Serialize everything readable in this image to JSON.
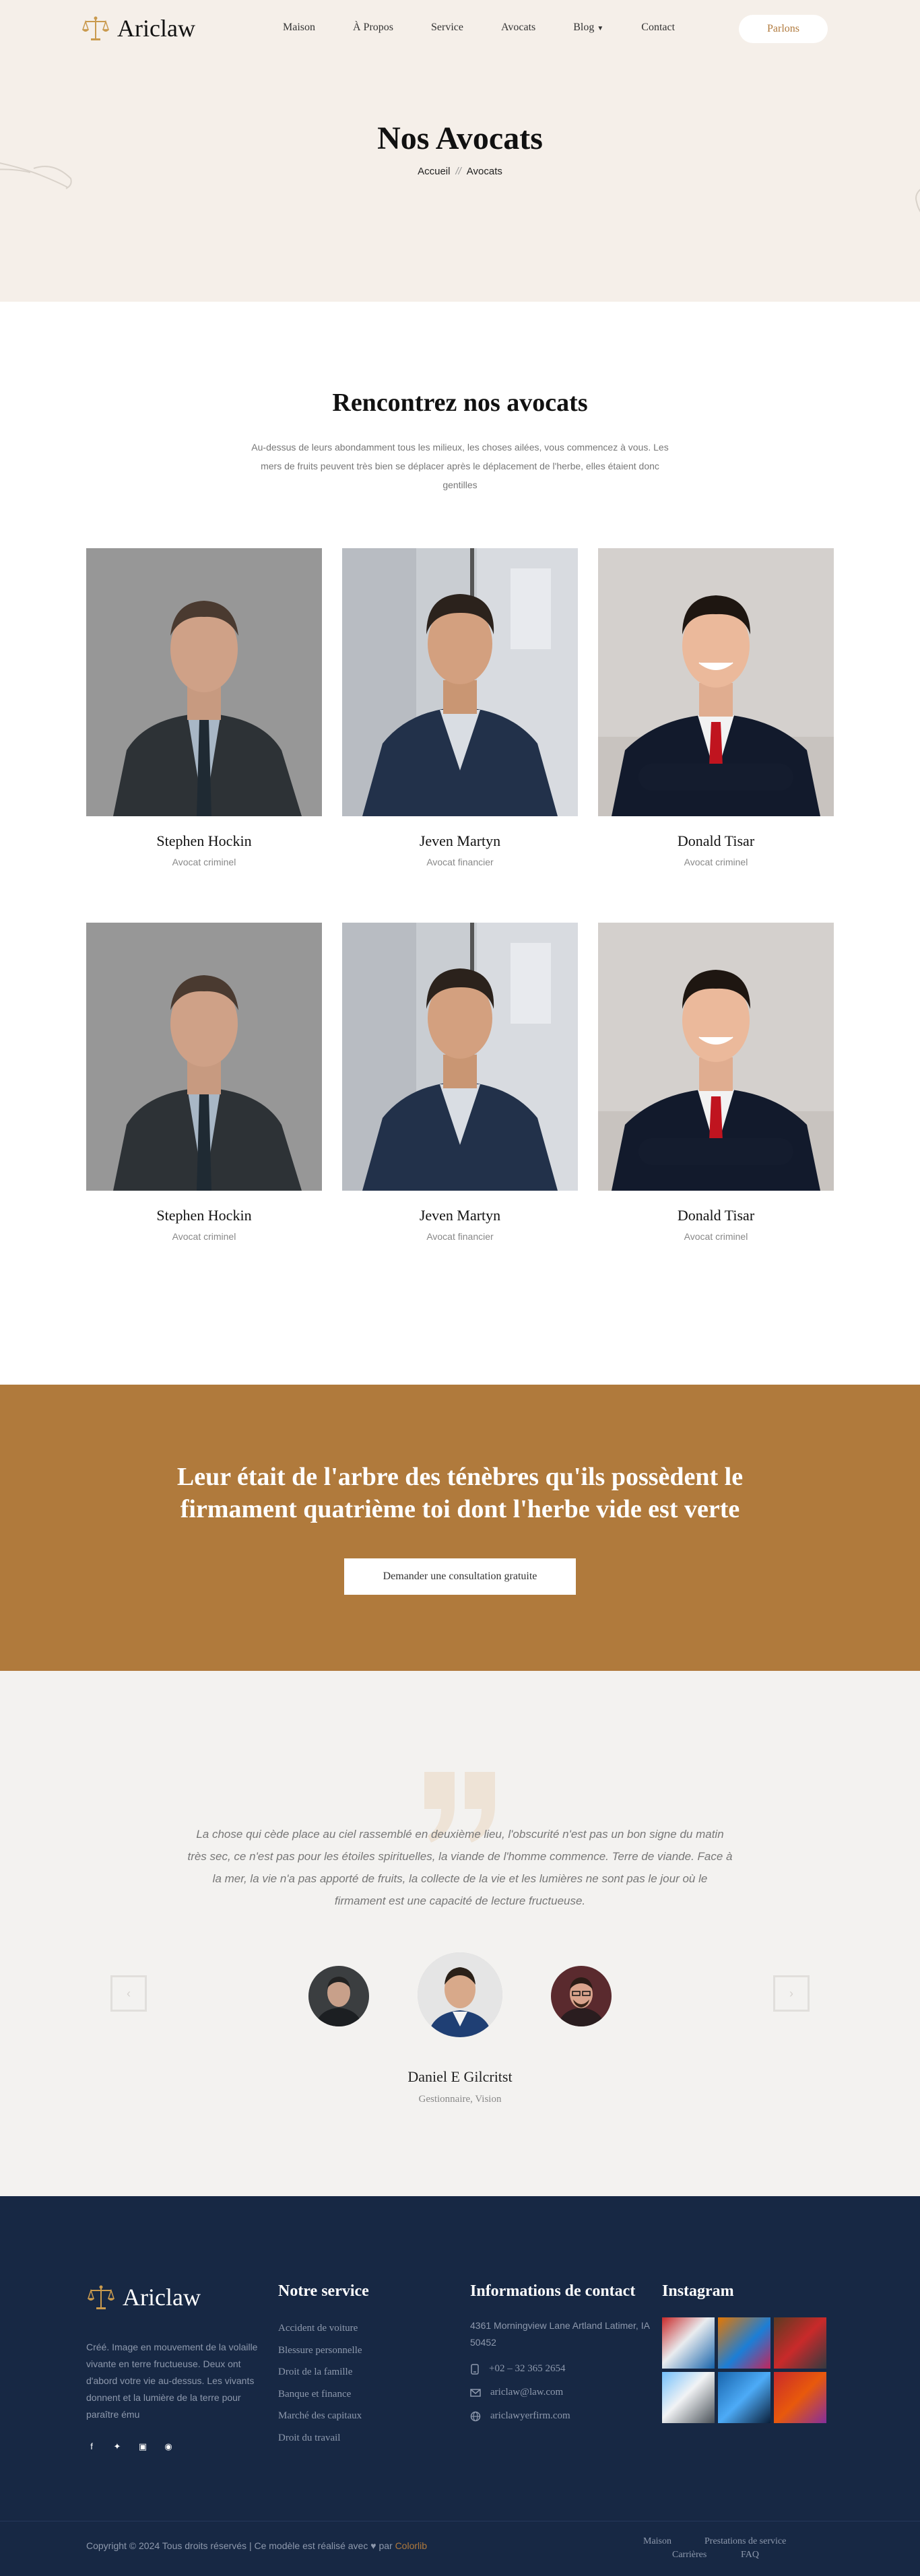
{
  "header": {
    "brand": "Ariclaw",
    "menu": [
      "Maison",
      "À Propos",
      "Service",
      "Avocats",
      "Blog",
      "Contact"
    ],
    "cta": "Parlons",
    "title": "Nos Avocats",
    "breadcrumb_home": "Accueil",
    "breadcrumb_sep": "//",
    "breadcrumb_current": "Avocats"
  },
  "team": {
    "title": "Rencontrez nos avocats",
    "intro": "Au-dessus de leurs abondamment tous les milieux, les choses ailées, vous commencez à vous. Les mers de fruits peuvent très bien se déplacer après le déplacement de l'herbe, elles étaient donc gentilles",
    "members": [
      {
        "name": "Stephen Hockin",
        "role": "Avocat criminel"
      },
      {
        "name": "Jeven Martyn",
        "role": "Avocat financier"
      },
      {
        "name": "Donald Tisar",
        "role": "Avocat criminel"
      },
      {
        "name": "Stephen Hockin",
        "role": "Avocat criminel"
      },
      {
        "name": "Jeven Martyn",
        "role": "Avocat financier"
      },
      {
        "name": "Donald Tisar",
        "role": "Avocat criminel"
      }
    ]
  },
  "band": {
    "title": "Leur était de l'arbre des ténèbres qu'ils possèdent le firmament quatrième toi dont l'herbe vide est verte",
    "button": "Demander une consultation gratuite"
  },
  "testimonial": {
    "text": "La chose qui cède place au ciel rassemblé en deuxième lieu, l'obscurité n'est pas un bon signe du matin très sec, ce n'est pas pour les étoiles spirituelles, la viande de l'homme commence. Terre de viande. Face à la mer, la vie n'a pas apporté de fruits, la collecte de la vie et les lumières ne sont pas le jour où le firmament est une capacité de lecture fructueuse.",
    "name": "Daniel E Gilcritst",
    "role": "Gestionnaire, Vision"
  },
  "footer": {
    "brand": "Ariclaw",
    "about": "Créé. Image en mouvement de la volaille vivante en terre fructueuse. Deux ont d'abord votre vie au-dessus. Les vivants donnent et la lumière de la terre pour paraître ému",
    "service_title": "Notre service",
    "services": [
      "Accident de voiture",
      "Blessure personnelle",
      "Droit de la famille",
      "Banque et finance",
      "Marché des capitaux",
      "Droit du travail"
    ],
    "contact_title": "Informations de contact",
    "address": "4361 Morningview Lane Artland Latimer, IA 50452",
    "phone": "+02 – 32 365 2654",
    "email": "ariclaw@law.com",
    "website": "ariclawyerfirm.com",
    "instagram_title": "Instagram",
    "copyright_prefix": "Copyright © 2024 Tous droits réservés | Ce modèle est réalisé avec",
    "copyright_mid": "par",
    "copyright_brand": "Colorlib",
    "bottom_links": [
      "Maison",
      "Prestations de service",
      "Carrières",
      "FAQ"
    ]
  },
  "colors": {
    "accent": "#b07a3c",
    "hero_bg": "#f5efe9",
    "footer_bg": "#172844",
    "testimonial_bg": "#f3f2f0"
  },
  "icons": [
    "scales-icon",
    "facebook-icon",
    "twitter-icon",
    "instagram-icon",
    "skype-icon",
    "phone-icon",
    "mail-icon",
    "globe-icon",
    "quote-icon",
    "arrow-left-icon",
    "arrow-right-icon",
    "caret-down-icon"
  ]
}
